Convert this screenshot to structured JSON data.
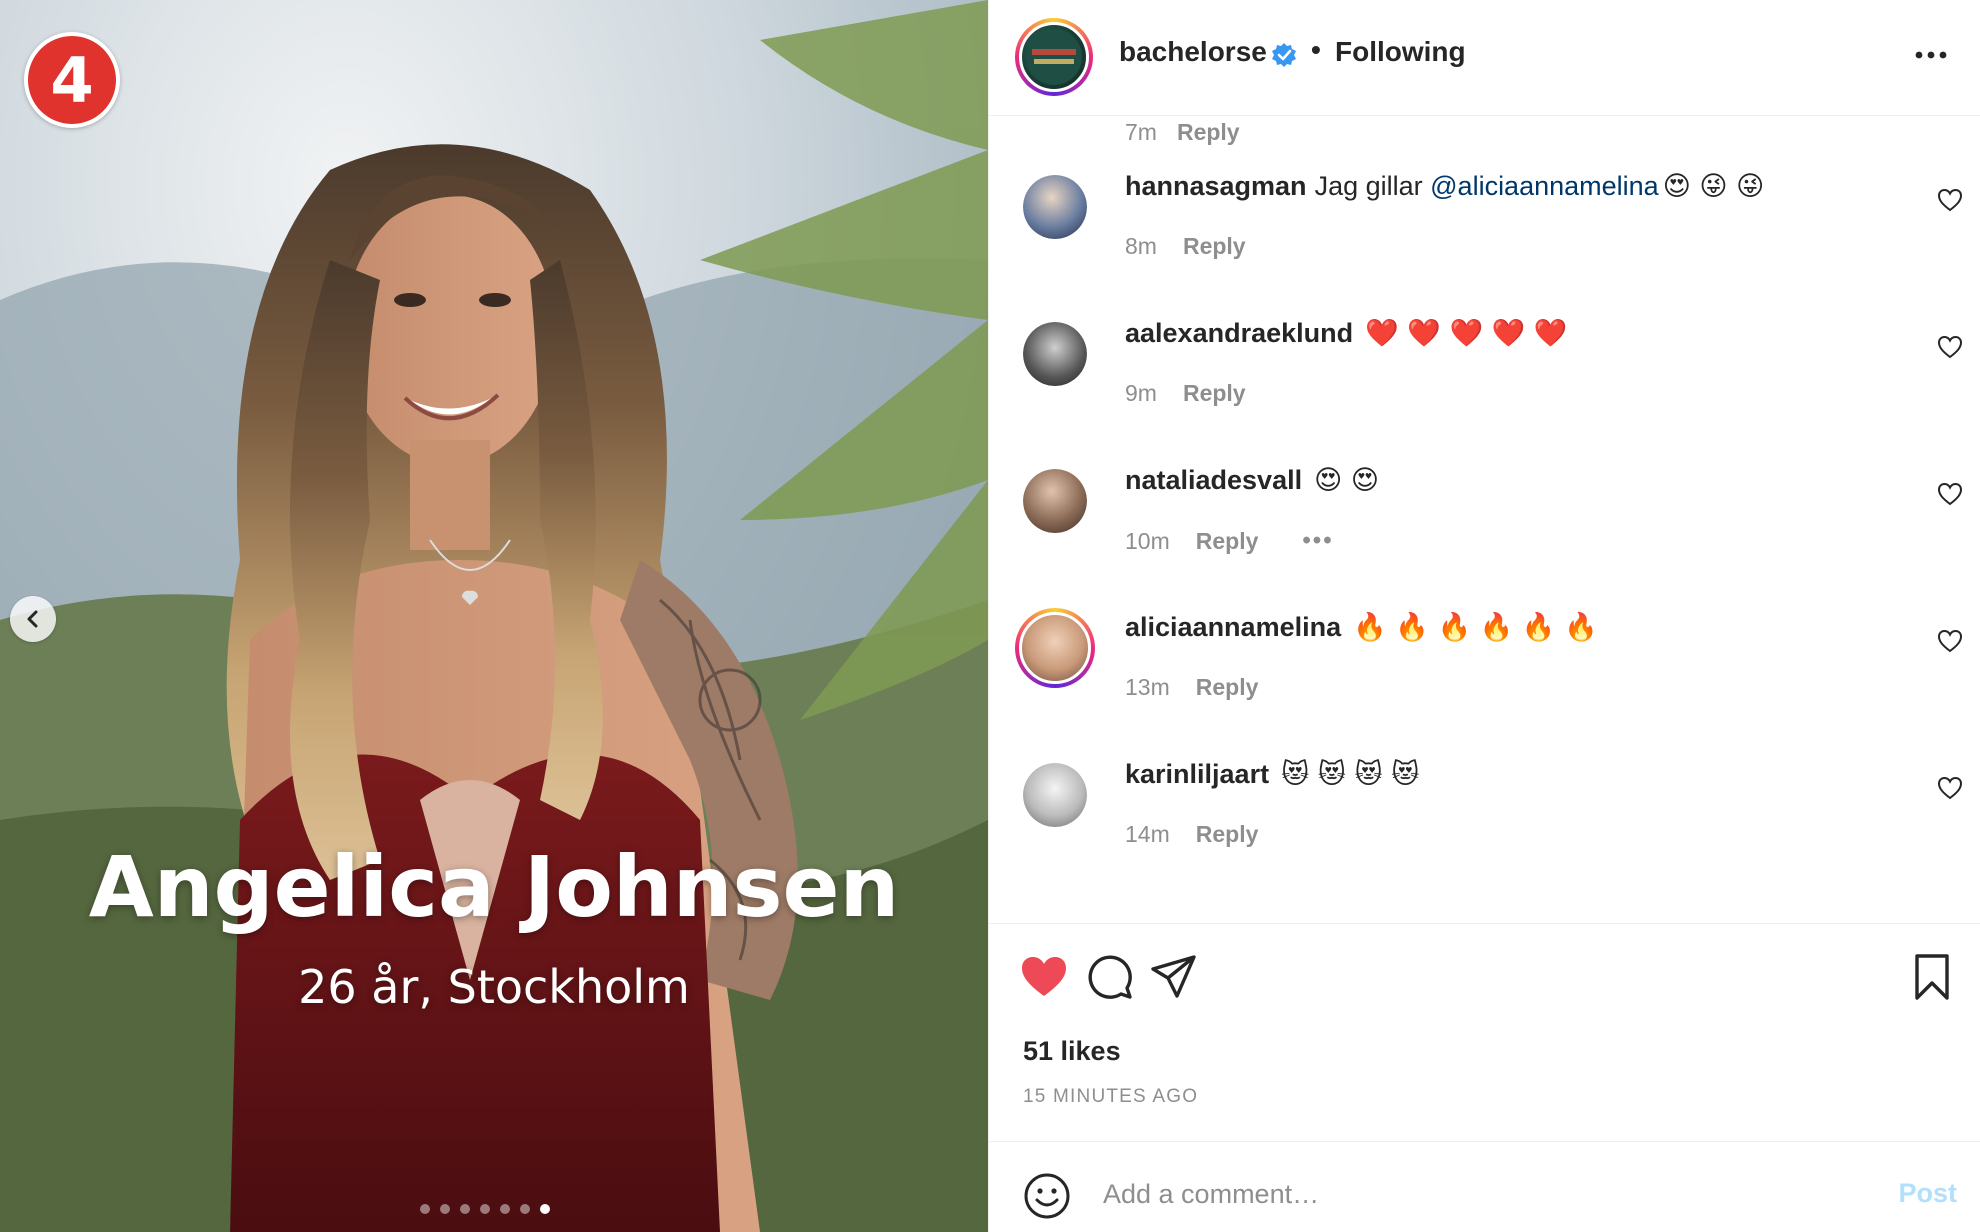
{
  "media": {
    "overlay_name": "Angelica Johnsen",
    "overlay_subtitle": "26 år, Stockholm",
    "carousel_total": 7,
    "carousel_active_index": 6,
    "channel_logo_text": "4",
    "channel_logo_color": "#e0332e"
  },
  "header": {
    "username": "bachelorse",
    "separator": "•",
    "follow_status": "Following",
    "verified_color": "#3897f0"
  },
  "previous_comment_meta": {
    "time": "7m",
    "reply_label": "Reply"
  },
  "comments": [
    {
      "username": "hannasagman",
      "text": "Jag gillar",
      "mention": "@aliciaannamelina",
      "emoji": "😍 😜 😜",
      "time": "8m",
      "reply_label": "Reply"
    },
    {
      "username": "aalexandraeklund",
      "text": "",
      "mention": "",
      "emoji": "❤️ ❤️ ❤️ ❤️ ❤️",
      "time": "9m",
      "reply_label": "Reply"
    },
    {
      "username": "nataliadesvall",
      "text": "",
      "mention": "",
      "emoji": "😍 😍",
      "time": "10m",
      "reply_label": "Reply",
      "more": "•••"
    },
    {
      "username": "aliciaannamelina",
      "text": "",
      "mention": "",
      "emoji": "🔥 🔥 🔥 🔥 🔥 🔥",
      "time": "13m",
      "reply_label": "Reply",
      "story_ring": true
    },
    {
      "username": "karinliljaart",
      "text": "",
      "mention": "",
      "emoji": "😻 😻 😻 😻",
      "time": "14m",
      "reply_label": "Reply"
    }
  ],
  "actions": {
    "liked": true,
    "like_color": "#ed4956",
    "likes_text": "51 likes",
    "time_ago": "15 MINUTES AGO"
  },
  "add_comment": {
    "placeholder": "Add a comment…",
    "post_label": "Post",
    "post_color": "#b2dffc"
  }
}
